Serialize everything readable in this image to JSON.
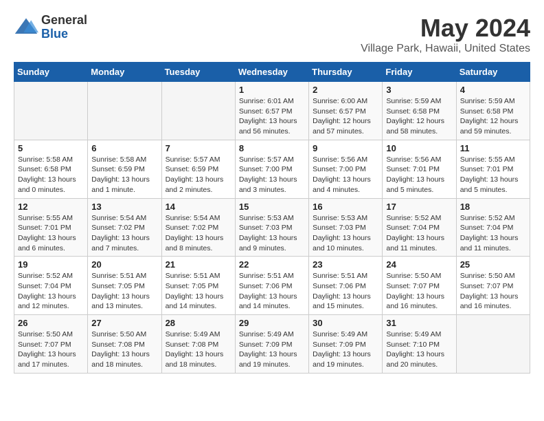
{
  "logo": {
    "general": "General",
    "blue": "Blue"
  },
  "title": "May 2024",
  "subtitle": "Village Park, Hawaii, United States",
  "days_of_week": [
    "Sunday",
    "Monday",
    "Tuesday",
    "Wednesday",
    "Thursday",
    "Friday",
    "Saturday"
  ],
  "weeks": [
    [
      {
        "day": "",
        "info": ""
      },
      {
        "day": "",
        "info": ""
      },
      {
        "day": "",
        "info": ""
      },
      {
        "day": "1",
        "info": "Sunrise: 6:01 AM\nSunset: 6:57 PM\nDaylight: 13 hours\nand 56 minutes."
      },
      {
        "day": "2",
        "info": "Sunrise: 6:00 AM\nSunset: 6:57 PM\nDaylight: 12 hours\nand 57 minutes."
      },
      {
        "day": "3",
        "info": "Sunrise: 5:59 AM\nSunset: 6:58 PM\nDaylight: 12 hours\nand 58 minutes."
      },
      {
        "day": "4",
        "info": "Sunrise: 5:59 AM\nSunset: 6:58 PM\nDaylight: 12 hours\nand 59 minutes."
      }
    ],
    [
      {
        "day": "5",
        "info": "Sunrise: 5:58 AM\nSunset: 6:58 PM\nDaylight: 13 hours\nand 0 minutes."
      },
      {
        "day": "6",
        "info": "Sunrise: 5:58 AM\nSunset: 6:59 PM\nDaylight: 13 hours\nand 1 minute."
      },
      {
        "day": "7",
        "info": "Sunrise: 5:57 AM\nSunset: 6:59 PM\nDaylight: 13 hours\nand 2 minutes."
      },
      {
        "day": "8",
        "info": "Sunrise: 5:57 AM\nSunset: 7:00 PM\nDaylight: 13 hours\nand 3 minutes."
      },
      {
        "day": "9",
        "info": "Sunrise: 5:56 AM\nSunset: 7:00 PM\nDaylight: 13 hours\nand 4 minutes."
      },
      {
        "day": "10",
        "info": "Sunrise: 5:56 AM\nSunset: 7:01 PM\nDaylight: 13 hours\nand 5 minutes."
      },
      {
        "day": "11",
        "info": "Sunrise: 5:55 AM\nSunset: 7:01 PM\nDaylight: 13 hours\nand 5 minutes."
      }
    ],
    [
      {
        "day": "12",
        "info": "Sunrise: 5:55 AM\nSunset: 7:01 PM\nDaylight: 13 hours\nand 6 minutes."
      },
      {
        "day": "13",
        "info": "Sunrise: 5:54 AM\nSunset: 7:02 PM\nDaylight: 13 hours\nand 7 minutes."
      },
      {
        "day": "14",
        "info": "Sunrise: 5:54 AM\nSunset: 7:02 PM\nDaylight: 13 hours\nand 8 minutes."
      },
      {
        "day": "15",
        "info": "Sunrise: 5:53 AM\nSunset: 7:03 PM\nDaylight: 13 hours\nand 9 minutes."
      },
      {
        "day": "16",
        "info": "Sunrise: 5:53 AM\nSunset: 7:03 PM\nDaylight: 13 hours\nand 10 minutes."
      },
      {
        "day": "17",
        "info": "Sunrise: 5:52 AM\nSunset: 7:04 PM\nDaylight: 13 hours\nand 11 minutes."
      },
      {
        "day": "18",
        "info": "Sunrise: 5:52 AM\nSunset: 7:04 PM\nDaylight: 13 hours\nand 11 minutes."
      }
    ],
    [
      {
        "day": "19",
        "info": "Sunrise: 5:52 AM\nSunset: 7:04 PM\nDaylight: 13 hours\nand 12 minutes."
      },
      {
        "day": "20",
        "info": "Sunrise: 5:51 AM\nSunset: 7:05 PM\nDaylight: 13 hours\nand 13 minutes."
      },
      {
        "day": "21",
        "info": "Sunrise: 5:51 AM\nSunset: 7:05 PM\nDaylight: 13 hours\nand 14 minutes."
      },
      {
        "day": "22",
        "info": "Sunrise: 5:51 AM\nSunset: 7:06 PM\nDaylight: 13 hours\nand 14 minutes."
      },
      {
        "day": "23",
        "info": "Sunrise: 5:51 AM\nSunset: 7:06 PM\nDaylight: 13 hours\nand 15 minutes."
      },
      {
        "day": "24",
        "info": "Sunrise: 5:50 AM\nSunset: 7:07 PM\nDaylight: 13 hours\nand 16 minutes."
      },
      {
        "day": "25",
        "info": "Sunrise: 5:50 AM\nSunset: 7:07 PM\nDaylight: 13 hours\nand 16 minutes."
      }
    ],
    [
      {
        "day": "26",
        "info": "Sunrise: 5:50 AM\nSunset: 7:07 PM\nDaylight: 13 hours\nand 17 minutes."
      },
      {
        "day": "27",
        "info": "Sunrise: 5:50 AM\nSunset: 7:08 PM\nDaylight: 13 hours\nand 18 minutes."
      },
      {
        "day": "28",
        "info": "Sunrise: 5:49 AM\nSunset: 7:08 PM\nDaylight: 13 hours\nand 18 minutes."
      },
      {
        "day": "29",
        "info": "Sunrise: 5:49 AM\nSunset: 7:09 PM\nDaylight: 13 hours\nand 19 minutes."
      },
      {
        "day": "30",
        "info": "Sunrise: 5:49 AM\nSunset: 7:09 PM\nDaylight: 13 hours\nand 19 minutes."
      },
      {
        "day": "31",
        "info": "Sunrise: 5:49 AM\nSunset: 7:10 PM\nDaylight: 13 hours\nand 20 minutes."
      },
      {
        "day": "",
        "info": ""
      }
    ]
  ]
}
